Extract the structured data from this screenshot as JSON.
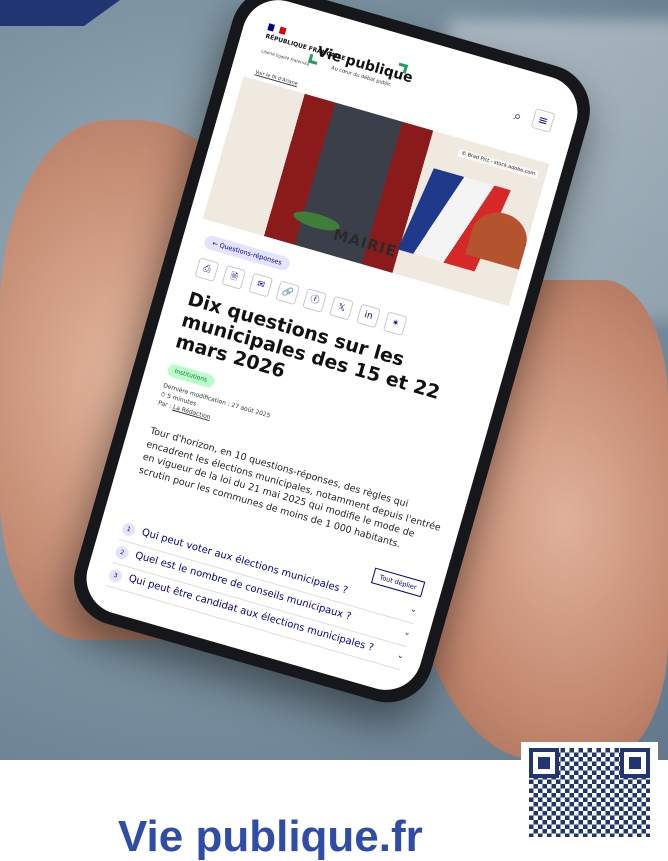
{
  "header": {
    "republique": "RÉPUBLIQUE FRANÇAISE",
    "motto": "Liberté Égalité Fraternité",
    "site_title": "Vie publique",
    "site_subtitle": "Au cœur du débat public"
  },
  "image": {
    "credit_link": "Voir le fil d'Ariane",
    "photo_credit": "© Brad Pict - stock.adobe.com",
    "sign_text": "MAIRIE"
  },
  "article": {
    "back_label": "← Questions-réponses",
    "share_icons": [
      "print-icon",
      "pdf-icon",
      "email-icon",
      "link-icon",
      "facebook-icon",
      "x-icon",
      "linkedin-icon",
      "bluesky-icon"
    ],
    "share_glyphs": [
      "⎙",
      "🗎",
      "✉",
      "🔗",
      "ⓕ",
      "𝕏",
      "in",
      "✶"
    ],
    "title": "Dix questions sur les municipales des 15 et 22 mars 2026",
    "tag": "Institutions",
    "last_modified": "Dernière modification : 27 août 2025",
    "read_time": "⏱ 5 minutes",
    "author_prefix": "Par : ",
    "author": "La Rédaction",
    "lead": "Tour d'horizon, en 10 questions-réponses, des règles qui encadrent les élections municipales, notamment depuis l'entrée en vigueur de la loi du 21 mai 2025 qui modifie le mode de scrutin pour les communes de moins de 1 000 habitants."
  },
  "accordion": {
    "expand_all": "Tout déplier",
    "items": [
      {
        "num": "1",
        "question": "Qui peut voter aux élections municipales ?"
      },
      {
        "num": "2",
        "question": "Quel est le nombre de conseils municipaux ?"
      },
      {
        "num": "3",
        "question": "Qui peut être candidat aux élections municipales ?"
      }
    ]
  },
  "page": {
    "bottom_text": "Vie publique.fr"
  },
  "colors": {
    "brand_blue": "#000091",
    "band": "#213573",
    "tag_green": "#18753c",
    "bottom_title": "#2f4da8"
  }
}
